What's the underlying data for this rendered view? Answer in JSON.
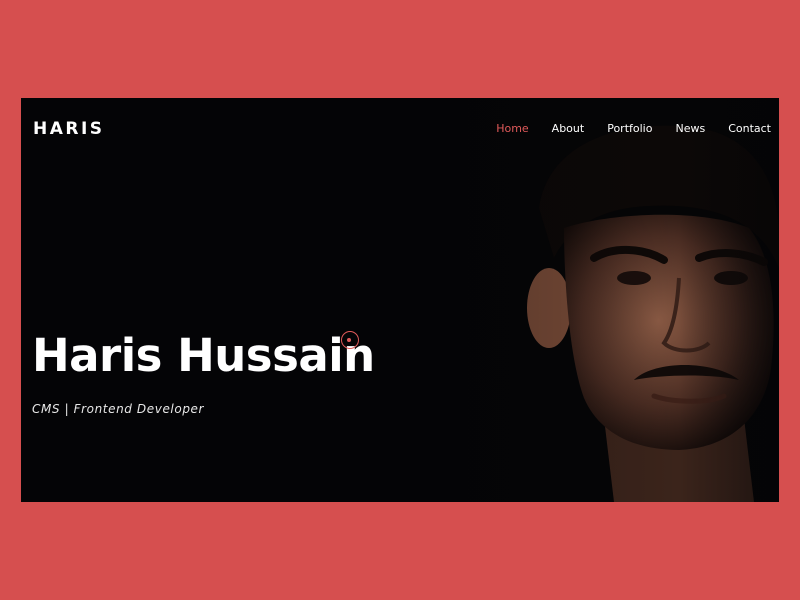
{
  "brand": {
    "logo_text": "HARIS"
  },
  "nav": {
    "items": [
      {
        "label": "Home",
        "active": true
      },
      {
        "label": "About",
        "active": false
      },
      {
        "label": "Portfolio",
        "active": false
      },
      {
        "label": "News",
        "active": false
      },
      {
        "label": "Contact",
        "active": false
      }
    ]
  },
  "hero": {
    "title": "Haris Hussain",
    "subtitle": "CMS | Frontend Developer"
  },
  "colors": {
    "page_background": "#d64f4f",
    "hero_background": "#040406",
    "accent": "#e05a5a",
    "text": "#ffffff"
  },
  "icons": {
    "cursor": "custom-cursor-ring-icon"
  }
}
